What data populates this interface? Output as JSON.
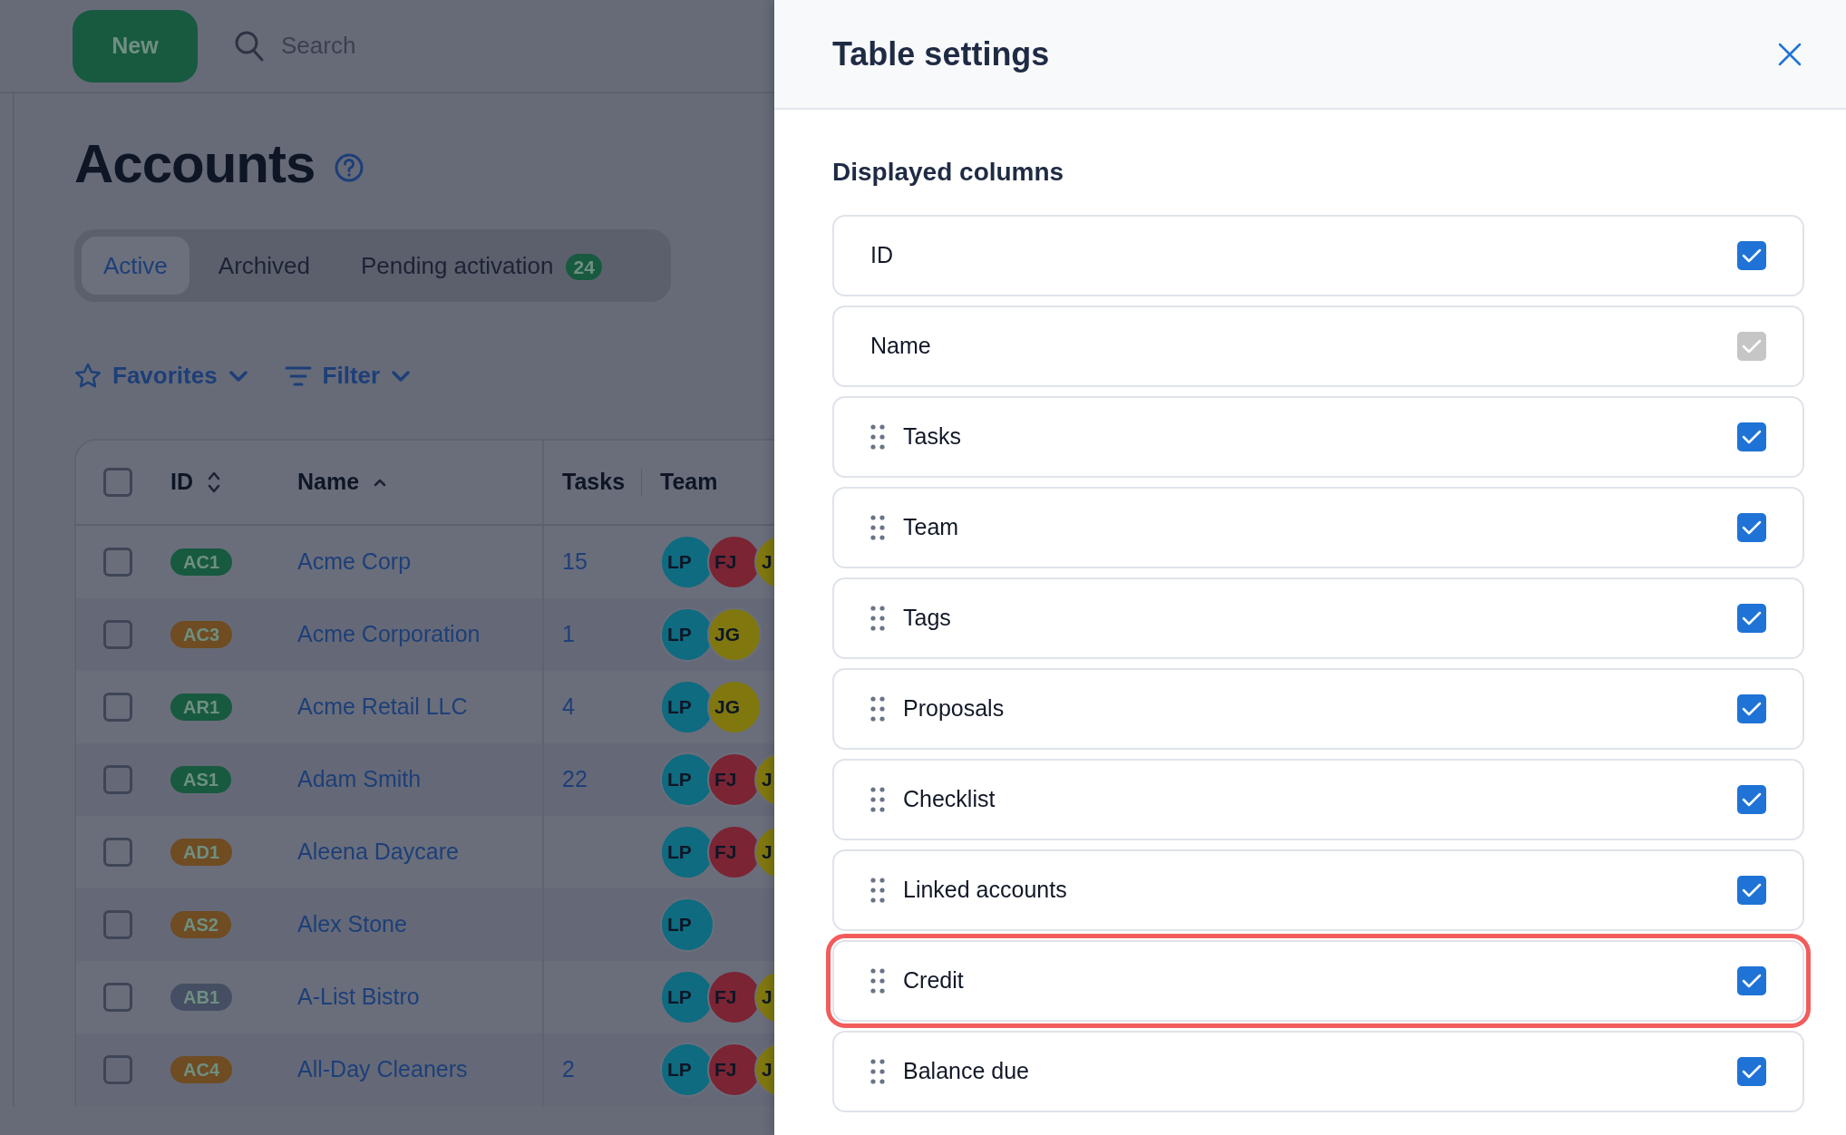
{
  "toolbar": {
    "new_button": "New",
    "search": {
      "placeholder": "Search"
    }
  },
  "page": {
    "title": "Accounts"
  },
  "tabs": [
    {
      "label": "Active",
      "selected": true
    },
    {
      "label": "Archived",
      "selected": false
    },
    {
      "label": "Pending activation",
      "count": "24",
      "selected": false
    }
  ],
  "filters": [
    {
      "kind": "favorites",
      "label": "Favorites"
    },
    {
      "kind": "filter",
      "label": "Filter"
    }
  ],
  "table": {
    "select_all_checked": false,
    "columns": [
      {
        "label": "ID",
        "kind": "sortable"
      },
      {
        "label": "Name",
        "kind": "sorted"
      },
      {
        "label": "Tasks",
        "kind": "plain"
      },
      {
        "label": "Team",
        "kind": "plain"
      }
    ],
    "rows": [
      {
        "checked": false,
        "id": "AC1",
        "color": "#175a3f",
        "name": "Acme Corp",
        "tasks": "15",
        "team": [
          {
            "initials": "LP",
            "color": "#0e6b80"
          },
          {
            "initials": "FJ",
            "color": "#7b2434"
          },
          {
            "initials": "J",
            "color": "#80780f"
          }
        ]
      },
      {
        "checked": false,
        "id": "AC3",
        "color": "#6f4c22",
        "name": "Acme Corporation",
        "tasks": "1",
        "team": [
          {
            "initials": "LP",
            "color": "#0e6b80"
          },
          {
            "initials": "JG",
            "color": "#80780f"
          }
        ]
      },
      {
        "checked": false,
        "id": "AR1",
        "color": "#175a3f",
        "name": "Acme Retail LLC",
        "tasks": "4",
        "team": [
          {
            "initials": "LP",
            "color": "#0e6b80"
          },
          {
            "initials": "JG",
            "color": "#80780f"
          }
        ]
      },
      {
        "checked": false,
        "id": "AS1",
        "color": "#175a3f",
        "name": "Adam Smith",
        "tasks": "22",
        "team": [
          {
            "initials": "LP",
            "color": "#0e6b80"
          },
          {
            "initials": "FJ",
            "color": "#7b2434"
          },
          {
            "initials": "J",
            "color": "#80780f"
          }
        ]
      },
      {
        "checked": false,
        "id": "AD1",
        "color": "#6f4c22",
        "name": "Aleena Daycare",
        "team": [
          {
            "initials": "LP",
            "color": "#0e6b80"
          },
          {
            "initials": "FJ",
            "color": "#7b2434"
          },
          {
            "initials": "J",
            "color": "#80780f"
          }
        ]
      },
      {
        "checked": false,
        "id": "AS2",
        "color": "#6f4c22",
        "name": "Alex Stone",
        "team": [
          {
            "initials": "LP",
            "color": "#0e6b80"
          }
        ]
      },
      {
        "checked": false,
        "id": "AB1",
        "color": "#454e63",
        "name": "A-List Bistro",
        "team": [
          {
            "initials": "LP",
            "color": "#0e6b80"
          },
          {
            "initials": "FJ",
            "color": "#7b2434"
          },
          {
            "initials": "J",
            "color": "#80780f"
          }
        ]
      },
      {
        "checked": false,
        "id": "AC4",
        "color": "#6f4c22",
        "name": "All-Day Cleaners",
        "tasks": "2",
        "team": [
          {
            "initials": "LP",
            "color": "#0e6b80"
          },
          {
            "initials": "FJ",
            "color": "#7b2434"
          },
          {
            "initials": "J",
            "color": "#80780f"
          }
        ]
      }
    ]
  },
  "settings": {
    "title": "Table settings",
    "section": "Displayed columns",
    "columns": [
      {
        "label": "ID",
        "draggable": false,
        "checked": true,
        "disabled": false,
        "highlighted": false
      },
      {
        "label": "Name",
        "draggable": false,
        "checked": true,
        "disabled": true,
        "highlighted": false
      },
      {
        "label": "Tasks",
        "draggable": true,
        "checked": true,
        "disabled": false,
        "highlighted": false
      },
      {
        "label": "Team",
        "draggable": true,
        "checked": true,
        "disabled": false,
        "highlighted": false
      },
      {
        "label": "Tags",
        "draggable": true,
        "checked": true,
        "disabled": false,
        "highlighted": false
      },
      {
        "label": "Proposals",
        "draggable": true,
        "checked": true,
        "disabled": false,
        "highlighted": false
      },
      {
        "label": "Checklist",
        "draggable": true,
        "checked": true,
        "disabled": false,
        "highlighted": false
      },
      {
        "label": "Linked accounts",
        "draggable": true,
        "checked": true,
        "disabled": false,
        "highlighted": false
      },
      {
        "label": "Credit",
        "draggable": true,
        "checked": true,
        "disabled": false,
        "highlighted": true
      },
      {
        "label": "Balance due",
        "draggable": true,
        "checked": true,
        "disabled": false,
        "highlighted": false
      }
    ]
  }
}
